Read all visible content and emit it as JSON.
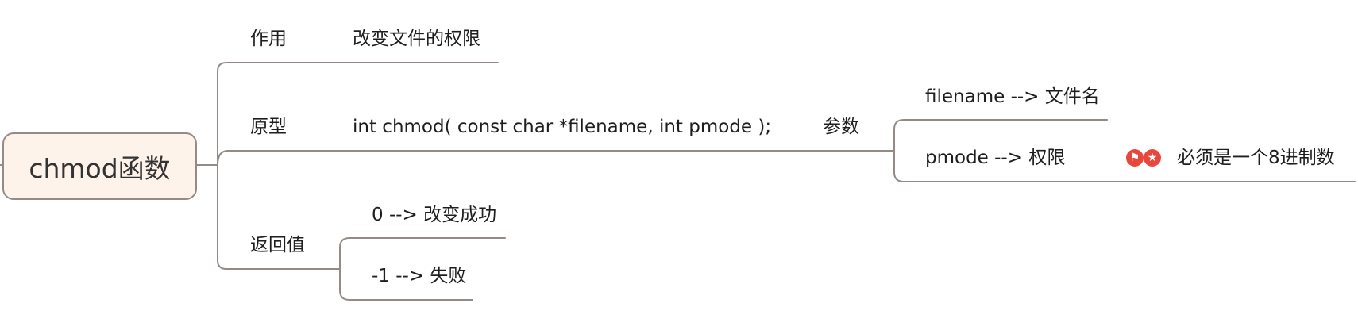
{
  "root": {
    "label": "chmod函数"
  },
  "branches": {
    "purpose": {
      "label": "作用",
      "detail": "改变文件的权限"
    },
    "prototype": {
      "label": "原型",
      "signature": "int chmod( const char *filename, int pmode );",
      "params": {
        "label": "参数",
        "filename": "filename --> 文件名",
        "pmode": "pmode --> 权限",
        "pmode_note": "必须是一个8进制数"
      }
    },
    "return_value": {
      "label": "返回值",
      "success": "0 --> 改变成功",
      "failure": "-1 --> 失败"
    }
  },
  "markers": [
    {
      "name": "flag-icon",
      "glyph": "⚑",
      "color": "#e8483c"
    },
    {
      "name": "star-icon",
      "glyph": "★",
      "color": "#e8483c"
    }
  ],
  "colors": {
    "line": "#948b86",
    "root_fill": "#fdf3ea",
    "text": "#1e1e1e"
  }
}
